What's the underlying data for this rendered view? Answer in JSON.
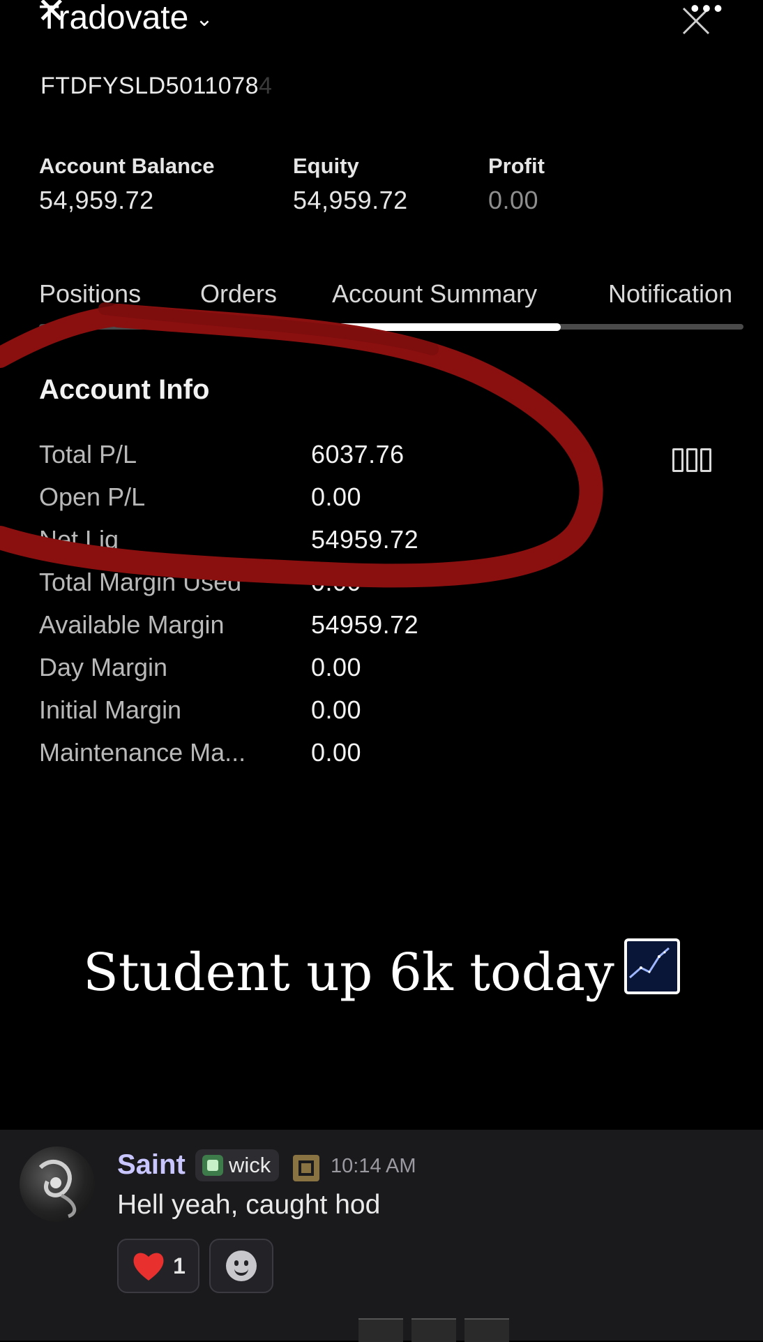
{
  "header": {
    "app_title": "Tradovate",
    "account_id": "FTDFYSLD5011078",
    "account_id_faded": "4"
  },
  "stats": [
    {
      "label": "Account Balance",
      "value": "54,959.72"
    },
    {
      "label": "Equity",
      "value": "54,959.72"
    },
    {
      "label": "Profit",
      "value": "0.00"
    }
  ],
  "tabs": [
    "Positions",
    "Orders",
    "Account Summary",
    "Notification"
  ],
  "active_tab": "Account Summary",
  "account_info": {
    "title": "Account Info",
    "rows": [
      {
        "label": "Total P/L",
        "value": "6037.76"
      },
      {
        "label": "Open P/L",
        "value": "0.00"
      },
      {
        "label": "Net Liq",
        "value": "54959.72"
      },
      {
        "label": "Total Margin Used",
        "value": "0.00"
      },
      {
        "label": "Available Margin",
        "value": "54959.72"
      },
      {
        "label": "Day Margin",
        "value": "0.00"
      },
      {
        "label": "Initial Margin",
        "value": "0.00"
      },
      {
        "label": "Maintenance Ma...",
        "value": "0.00"
      }
    ]
  },
  "caption": "Student up 6k today",
  "chat": {
    "username": "Saint",
    "role": "wick",
    "timestamp": "10:14 AM",
    "message": "Hell yeah, caught hod",
    "reaction_count": "1"
  },
  "colors": {
    "background": "#000000",
    "annotation_red": "#8a0f0f",
    "username": "#c9c6ff",
    "chat_panel": "#1a1a1d"
  }
}
